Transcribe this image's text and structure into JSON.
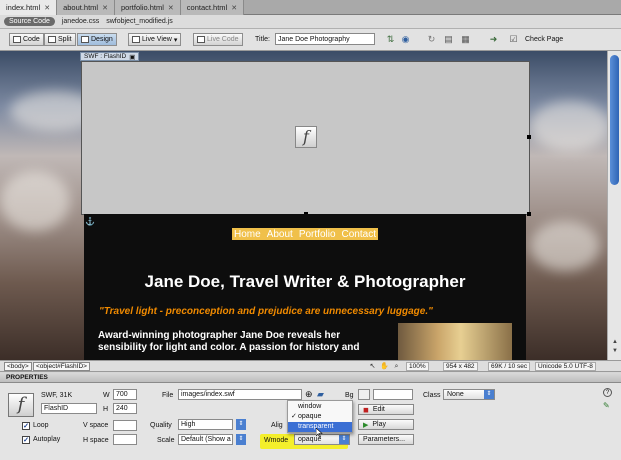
{
  "tabs": [
    {
      "label": "index.html",
      "close": "✕"
    },
    {
      "label": "about.html",
      "close": "✕"
    },
    {
      "label": "portfolio.html",
      "close": "✕"
    },
    {
      "label": "contact.html",
      "close": "✕"
    }
  ],
  "related_files": {
    "source": "Source Code",
    "files": [
      "janedoe.css",
      "swfobject_modified.js"
    ]
  },
  "doc_toolbar": {
    "code": "Code",
    "split": "Split",
    "design": "Design",
    "live_view": "Live View",
    "live_code": "Live Code",
    "title_label": "Title:",
    "title_value": "Jane Doe Photography",
    "check_page": "Check Page"
  },
  "design_view": {
    "swf_tag": "SWF : FlashID",
    "swf_tag_icon": "▣",
    "flash_glyph": "f",
    "anchor_glyph": "⚓",
    "nav": [
      "Home",
      "About",
      "Portfolio",
      "Contact"
    ],
    "heading": "Jane Doe, Travel Writer & Photographer",
    "tagline": "\"Travel light - preconception and prejudice are unnecessary luggage.\"",
    "body": "Award-winning photographer Jane Doe reveals her sensibility for light and color. A passion for history and"
  },
  "status_bar": {
    "tags": [
      "<body>",
      "<object#FlashID>"
    ],
    "zoom": "100%",
    "size": "954 x 482",
    "download": "69K / 10 sec",
    "encoding": "Unicode 5.0 UTF-8"
  },
  "properties": {
    "header": "PROPERTIES",
    "swf_info": "SWF, 31K",
    "swf_glyph": "f",
    "id": "FlashID",
    "w_label": "W",
    "w": "700",
    "h_label": "H",
    "h": "240",
    "file_label": "File",
    "file": "images/index.swf",
    "bg_label": "Bg",
    "edit": "Edit",
    "class_label": "Class",
    "class_value": "None",
    "loop": "Loop",
    "autoplay": "Autoplay",
    "vspace_label": "V space",
    "hspace_label": "H space",
    "quality_label": "Quality",
    "quality": "High",
    "scale_label": "Scale",
    "scale": "Default (Show a",
    "align_label": "Alig",
    "wmode_label": "Wmode",
    "wmode": "opaque",
    "play": "Play",
    "parameters": "Parameters...",
    "help": "?"
  },
  "wmode_menu": {
    "options": [
      "window",
      "opaque",
      "transparent"
    ],
    "checked": "opaque",
    "highlighted": "transparent"
  },
  "colors": {
    "selection": "#3b6fd4",
    "highlight": "#f4ef2b",
    "tagline": "#f08a00",
    "nav_bg": "#f0c04a"
  }
}
